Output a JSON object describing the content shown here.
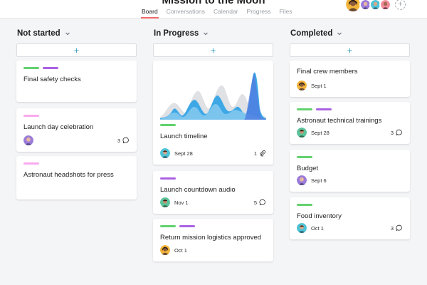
{
  "header": {
    "project_title": "Mission to the Moon",
    "tabs": [
      "Board",
      "Conversations",
      "Calendar",
      "Progress",
      "Files"
    ],
    "active_tab": "Board",
    "add_member_symbol": "+"
  },
  "colors": {
    "tag_green": "#62d26f",
    "tag_purple": "#aa62e3",
    "tag_pink": "#f9aaef",
    "accent_blue": "#3fa0c2",
    "chart_blue": "#3ea8e6"
  },
  "icons": {
    "comment": "comment-icon",
    "attachment": "paperclip-icon",
    "add": "plus-icon",
    "chevron": "chevron-down-icon"
  },
  "board": {
    "add_symbol": "+",
    "columns": [
      {
        "title": "Not started",
        "cards": [
          {
            "title": "Final safety checks",
            "tags": [
              "green",
              "purple"
            ]
          },
          {
            "title": "Launch day celebration",
            "tags": [
              "pink"
            ],
            "count": "3",
            "icon": "comment"
          },
          {
            "title": "Astronaut headshots for press",
            "tags": [
              "pink"
            ]
          }
        ]
      },
      {
        "title": "In Progress",
        "cards": [
          {
            "title": "Launch timeline",
            "tags": [
              "green"
            ],
            "due": "Sept 28",
            "count": "1",
            "icon": "attachment",
            "has_chart": true
          },
          {
            "title": "Launch countdown audio",
            "tags": [
              "purple"
            ],
            "due": "Nov 1",
            "count": "5",
            "icon": "comment"
          },
          {
            "title": "Return mission logistics approved",
            "tags": [
              "green",
              "purple"
            ],
            "due": "Oct 1"
          }
        ]
      },
      {
        "title": "Completed",
        "cards": [
          {
            "title": "Final crew members",
            "tags": [],
            "due": "Sept 1"
          },
          {
            "title": "Astronaut technical trainings",
            "tags": [
              "green",
              "purple"
            ],
            "due": "Sept 28",
            "count": "3",
            "icon": "comment"
          },
          {
            "title": "Budget",
            "tags": [
              "green"
            ],
            "due": "Sept 6"
          },
          {
            "title": "Food inventory",
            "tags": [
              "green"
            ],
            "due": "Oct 1",
            "count": "3",
            "icon": "comment"
          }
        ]
      }
    ]
  }
}
